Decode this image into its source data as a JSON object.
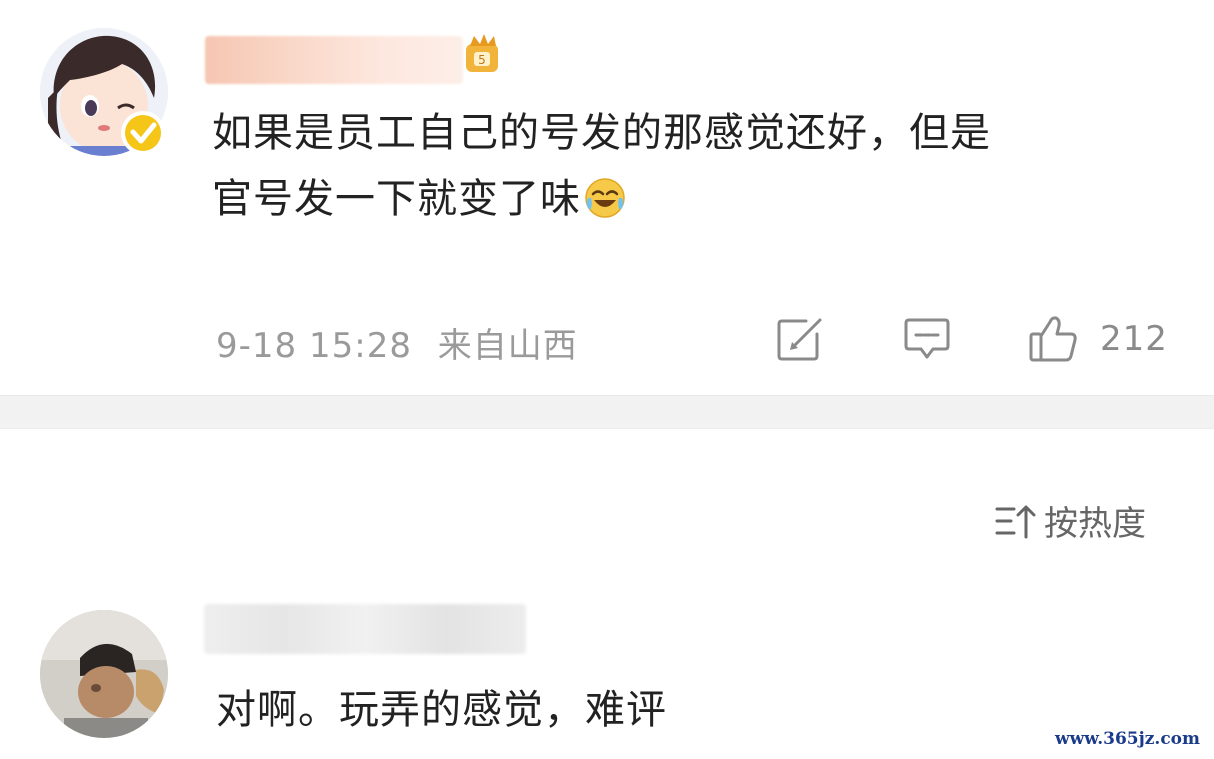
{
  "comment_top": {
    "text_line1": "如果是员工自己的号发的那感觉还好，但是",
    "text_line2": "官号发一下就变了味",
    "emoji": "laughing-crying-emoji",
    "timestamp": "9-18 15:28",
    "location": "来自山西",
    "like_count": "212",
    "icons": {
      "repost": "repost-icon",
      "reply": "comment-icon",
      "like": "thumbs-up-icon",
      "verified": "verified-badge-icon",
      "crown": "vip-crown-icon"
    }
  },
  "sort": {
    "label": "按热度",
    "icon": "sort-icon"
  },
  "comment_second": {
    "text": "对啊。玩弄的感觉，难评"
  },
  "watermark": "www.365jz.com",
  "colors": {
    "text_primary": "#222222",
    "text_meta": "#9a9a9a",
    "divider": "#f2f2f2",
    "verified_yellow": "#f5c518",
    "watermark_blue": "#1a3a8a"
  }
}
